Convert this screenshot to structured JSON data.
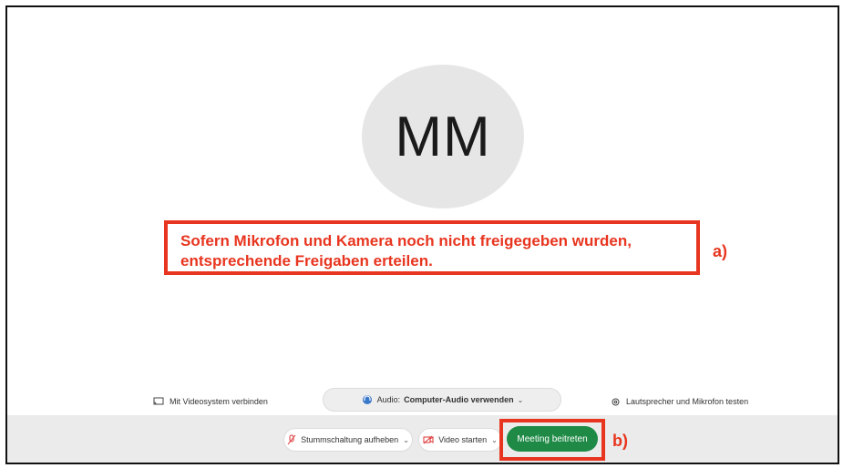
{
  "avatar": {
    "initials": "MM"
  },
  "annotation": {
    "line1": "Sofern Mikrofon und Kamera noch nicht freigegeben wurden,",
    "line2": "entsprechende Freigaben erteilen.",
    "marker_a": "a)",
    "marker_b": "b)",
    "highlight_color": "#e8351f"
  },
  "options": {
    "video_system_label": "Mit Videosystem verbinden",
    "audio_prefix": "Audio:",
    "audio_value": "Computer-Audio verwenden",
    "test_label": "Lautsprecher und Mikrofon testen"
  },
  "toolbar": {
    "unmute_label": "Stummschaltung aufheben",
    "video_label": "Video starten",
    "join_label": "Meeting beitreten",
    "join_color": "#1f8a46"
  },
  "icons": [
    "cast-icon",
    "headset-icon",
    "chevron-down-icon",
    "gear-icon",
    "mic-muted-icon",
    "video-off-icon"
  ]
}
